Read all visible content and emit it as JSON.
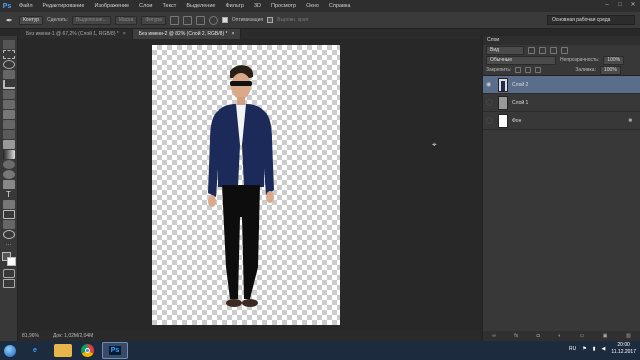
{
  "app": {
    "logo": "Ps"
  },
  "menu": [
    "Файл",
    "Редактирование",
    "Изображение",
    "Слои",
    "Текст",
    "Выделение",
    "Фильтр",
    "3D",
    "Просмотр",
    "Окно",
    "Справка"
  ],
  "options": {
    "mode": "Контур",
    "make_label": "Сделать:",
    "selection_btn": "Выделение...",
    "mask_btn": "Маска",
    "shape_btn": "Фигура",
    "align_label": "Оптимизация",
    "align_edges": "Выровн. края"
  },
  "workspace": "Основная рабочая среда",
  "tabs": [
    {
      "title": "Без имени-1 @ 67,2% (Слой 1, RGB/8) *",
      "close": "×"
    },
    {
      "title": "Без имени-2 @ 82% (Слой 2, RGB/8) *",
      "close": "×"
    }
  ],
  "status": {
    "zoom": "81,96%",
    "doc": "Док: 1,02M/2,04M"
  },
  "layers_panel": {
    "tab": "Слои",
    "kind": "Вид",
    "blend_mode": "Обычные",
    "opacity_label": "Непрозрачность:",
    "opacity_value": "100%",
    "lock_label": "Закрепить:",
    "fill_label": "Заливка:",
    "fill_value": "100%",
    "layers": [
      {
        "name": "Слой 2",
        "selected": true
      },
      {
        "name": "Слой 1",
        "selected": false
      },
      {
        "name": "Фон",
        "selected": false
      }
    ]
  },
  "taskbar": {
    "lang": "RU",
    "time": "20:00",
    "date": "11.12.2017",
    "ps_task": "Ps"
  },
  "colors": {
    "accent": "#5a6e8c",
    "ps_blue": "#4aa3ff"
  }
}
